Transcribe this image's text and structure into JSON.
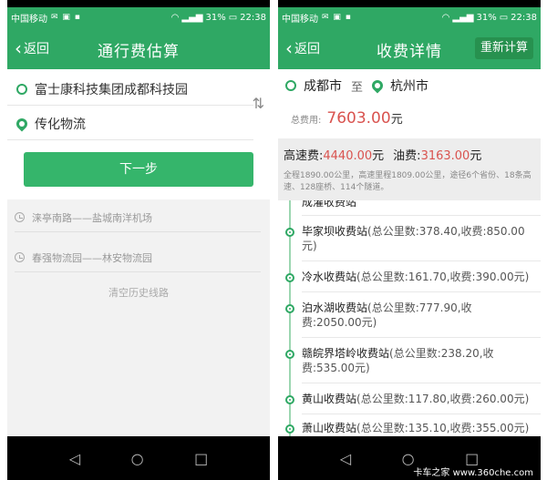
{
  "status": {
    "carrier": "中国移动",
    "battery": "31%",
    "time": "22:38"
  },
  "left": {
    "back_label": "返回",
    "title": "通行费估算",
    "origin": "富士康科技集团成都科技园",
    "destination": "传化物流",
    "next_button": "下一步",
    "history": [
      "涞亭南路——盐城南洋机场",
      "春强物流园——林安物流园"
    ],
    "clear_history": "清空历史线路"
  },
  "right": {
    "back_label": "返回",
    "title": "收费详情",
    "recalc_button": "重新计算",
    "from_city": "成都市",
    "to_word": "至",
    "to_city": "杭州市",
    "total_label": "总费用:",
    "total_value": "7603.00",
    "total_unit": "元",
    "highway_label": "高速费:",
    "highway_value": "4440.00",
    "highway_unit": "元",
    "fuel_label": "油费:",
    "fuel_value": "3163.00",
    "fuel_unit": "元",
    "note": "全程1890.00公里，高速里程1809.00公里，途径6个省份、18条高速、128座桥、114个隧道。",
    "stations": [
      {
        "name": "成灌收费站",
        "detail": ""
      },
      {
        "name": "毕家坝收费站",
        "detail": "(总公里数:378.40,收费:850.00元)"
      },
      {
        "name": "冷水收费站",
        "detail": "(总公里数:161.70,收费:390.00元)"
      },
      {
        "name": "泊水湖收费站",
        "detail": "(总公里数:777.90,收费:2050.00元)"
      },
      {
        "name": "赣皖界塔岭收费站",
        "detail": "(总公里数:238.20,收费:535.00元)"
      },
      {
        "name": "黄山收费站",
        "detail": "(总公里数:117.80,收费:260.00元)"
      },
      {
        "name": "萧山收费站",
        "detail": "(总公里数:135.10,收费:355.00元)"
      }
    ]
  },
  "watermark": "卡车之家 www.360che.com",
  "colors": {
    "brand_green": "#2fa864",
    "price_red": "#d9534f"
  },
  "nav_icons": [
    "back-triangle-icon",
    "home-circle-icon",
    "recent-square-icon"
  ]
}
